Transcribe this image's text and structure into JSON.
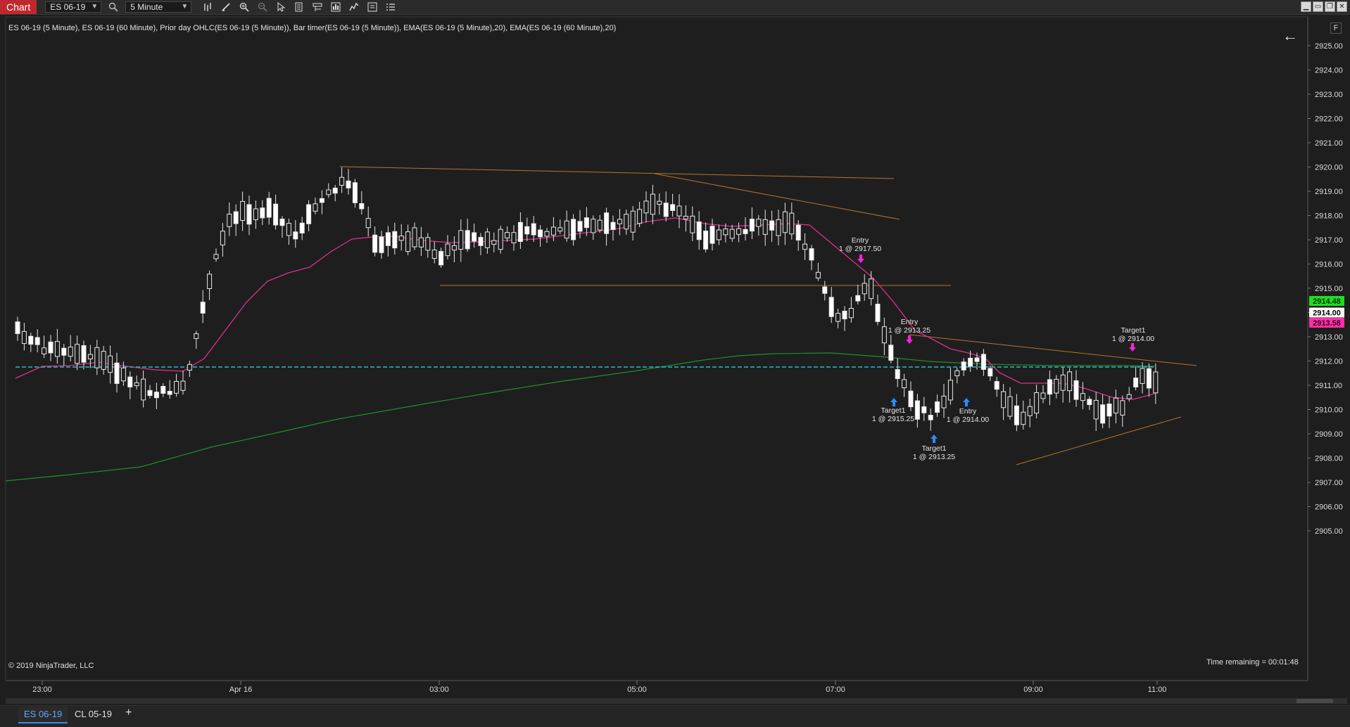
{
  "toolbar": {
    "chart_tab": "Chart",
    "instrument": "ES 06-19",
    "interval": "5 Minute",
    "icons": [
      "search-icon",
      "bar-type-icon",
      "drawing-tools-icon",
      "zoom-in-icon",
      "zoom-out-icon",
      "pointer-icon",
      "properties-icon",
      "templates-icon",
      "strategies-icon",
      "indicators-icon",
      "order-panel-icon"
    ]
  },
  "window_controls": [
    "minimize",
    "restore",
    "maximize",
    "close"
  ],
  "indicator_label": "ES 06-19 (5 Minute), ES 06-19 (60 Minute), Prior day OHLC(ES 06-19 (5 Minute)), Bar timer(ES 06-19 (5 Minute)), EMA(ES 06-19 (5 Minute),20), EMA(ES 06-19 (60 Minute),20)",
  "f_button": "F",
  "copyright": "© 2019 NinjaTrader, LLC",
  "time_remaining": "Time remaining = 00:01:48",
  "price_axis": [
    "2925.00",
    "2924.00",
    "2923.00",
    "2922.00",
    "2921.00",
    "2920.00",
    "2919.00",
    "2918.00",
    "2917.00",
    "2916.00",
    "2915.00",
    "2914.00",
    "2913.00",
    "2912.00",
    "2911.00",
    "2910.00",
    "2909.00",
    "2908.00",
    "2907.00",
    "2906.00",
    "2905.00"
  ],
  "price_markers": [
    {
      "label": "2914.48",
      "price": 2914.48,
      "color": "#22dd22",
      "text_color": "#003300"
    },
    {
      "label": "2914.00",
      "price": 2914.0,
      "color": "#ffffff",
      "text_color": "#000000"
    },
    {
      "label": "2913.58",
      "price": 2913.58,
      "color": "#ff2fa8",
      "text_color": "#330022"
    }
  ],
  "time_axis": [
    "23:00",
    "Apr 16",
    "03:00",
    "05:00",
    "07:00",
    "09:00",
    "11:00"
  ],
  "annotations": [
    {
      "line1": "Entry",
      "line2": "1 @ 2917.50"
    },
    {
      "line1": "Entry",
      "line2": "1 @ 2913.25"
    },
    {
      "line1": "Target1",
      "line2": "1 @ 2915.25"
    },
    {
      "line1": "Target1",
      "line2": "1 @ 2913.25"
    },
    {
      "line1": "Entry",
      "line2": "1 @ 2914.00"
    },
    {
      "line1": "Target1",
      "line2": "1 @ 2914.00"
    }
  ],
  "colors": {
    "ema5": "#e0308a",
    "ema60": "#1f8f2a",
    "trendlines": "#b8732a",
    "current_price_line": "#2bb8c8",
    "candle_up": "#ffffff",
    "candle_down": "#ffffff",
    "sell_arrow": "#ff22dd",
    "buy_arrow": "#2a8cff"
  },
  "bottom_tabs": {
    "active": "ES 06-19",
    "inactive": "CL 05-19",
    "add": "+"
  }
}
